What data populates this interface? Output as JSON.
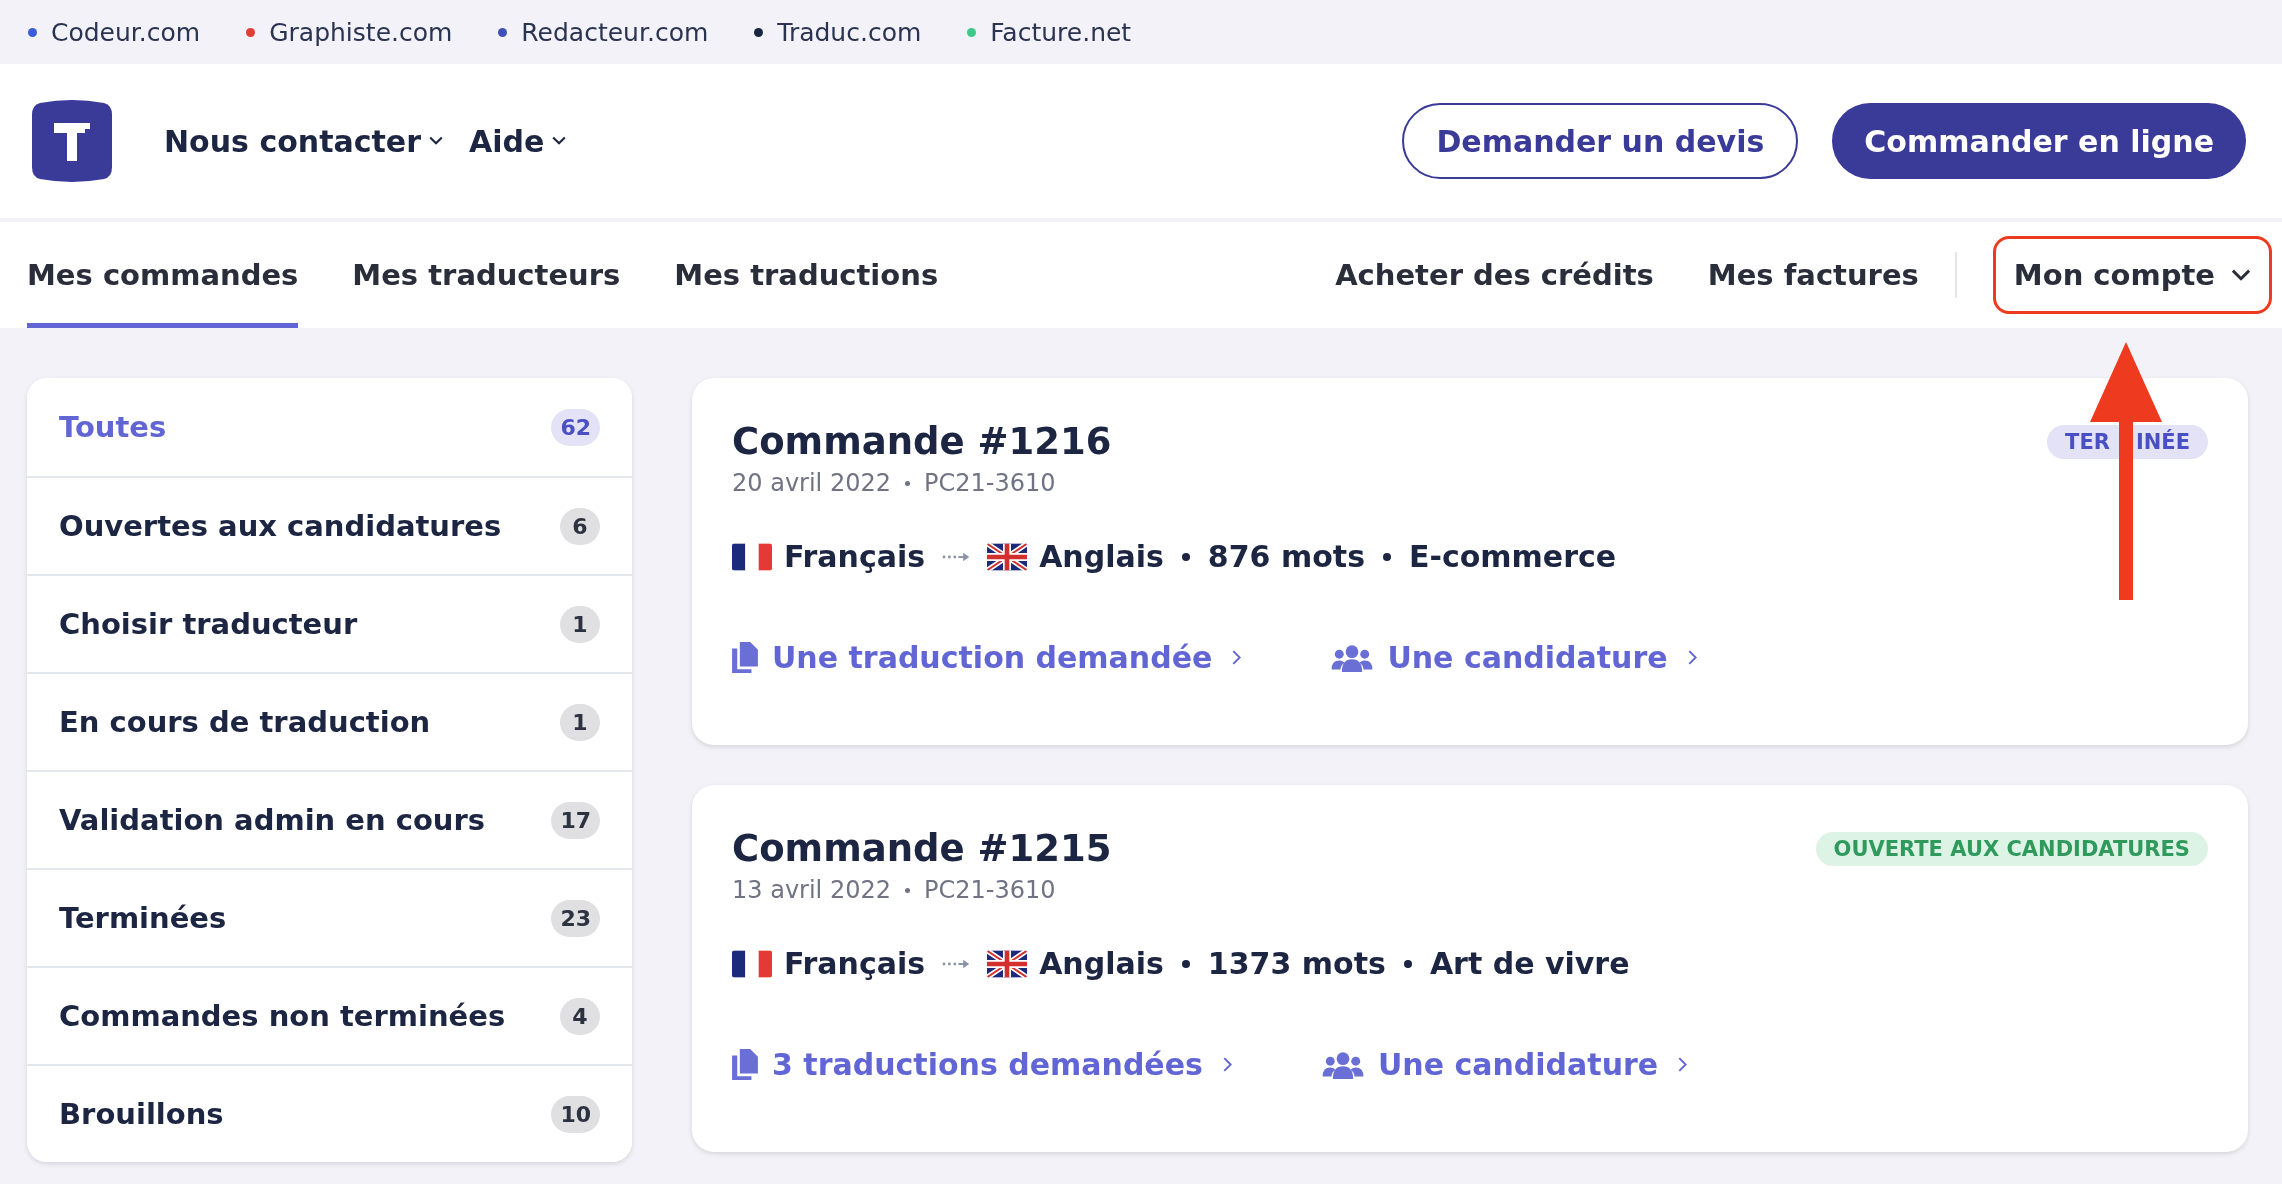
{
  "network_links": [
    {
      "label": "Codeur.com",
      "color": "#3b5bdb"
    },
    {
      "label": "Graphiste.com",
      "color": "#e03e36"
    },
    {
      "label": "Redacteur.com",
      "color": "#3f51b5"
    },
    {
      "label": "Traduc.com",
      "color": "#1b2541"
    },
    {
      "label": "Facture.net",
      "color": "#3cc98a"
    }
  ],
  "header": {
    "nav": [
      "Nous contacter",
      "Aide"
    ],
    "buttons": [
      {
        "label": "Demander un devis",
        "kind": "outline"
      },
      {
        "label": "Commander en ligne",
        "kind": "primary"
      }
    ]
  },
  "tabs": [
    {
      "label": "Mes commandes",
      "selected": true
    },
    {
      "label": "Mes traducteurs",
      "selected": false
    },
    {
      "label": "Mes traductions",
      "selected": false
    }
  ],
  "right_tabs": [
    {
      "label": "Acheter des crédits",
      "kind": "link"
    },
    {
      "label": "Mes factures",
      "kind": "link"
    },
    {
      "label": "Mon compte",
      "kind": "dropdown",
      "highlighted": true
    }
  ],
  "sidebar": {
    "items": [
      {
        "label": "Toutes",
        "count": "62",
        "selected": true
      },
      {
        "label": "Ouvertes aux candidatures",
        "count": "6",
        "selected": false
      },
      {
        "label": "Choisir traducteur",
        "count": "1",
        "selected": false
      },
      {
        "label": "En cours de traduction",
        "count": "1",
        "selected": false
      },
      {
        "label": "Validation admin en cours",
        "count": "17",
        "selected": false
      },
      {
        "label": "Terminées",
        "count": "23",
        "selected": false
      },
      {
        "label": "Commandes non terminées",
        "count": "4",
        "selected": false
      },
      {
        "label": "Brouillons",
        "count": "10",
        "selected": false
      }
    ]
  },
  "orders": [
    {
      "title": "Commande #1216",
      "date": "20 avril 2022",
      "ref": "PC21-3610",
      "status": "TER",
      "status_rest": "INÉE",
      "kind": "done",
      "source": "Français",
      "target": "Anglais",
      "words": "876 mots",
      "domain": "E-commerce",
      "translations_link": "Une traduction demandée",
      "applications_link": "Une candidature",
      "arrow": true
    },
    {
      "title": "Commande #1215",
      "date": "13 avril 2022",
      "ref": "PC21-3610",
      "status": "OUVERTE AUX CANDIDATURES",
      "kind": "open",
      "source": "Français",
      "target": "Anglais",
      "words": "1373 mots",
      "domain": "Art de vivre",
      "translations_link": "3 traductions demandées",
      "applications_link": "Une candidature"
    }
  ]
}
